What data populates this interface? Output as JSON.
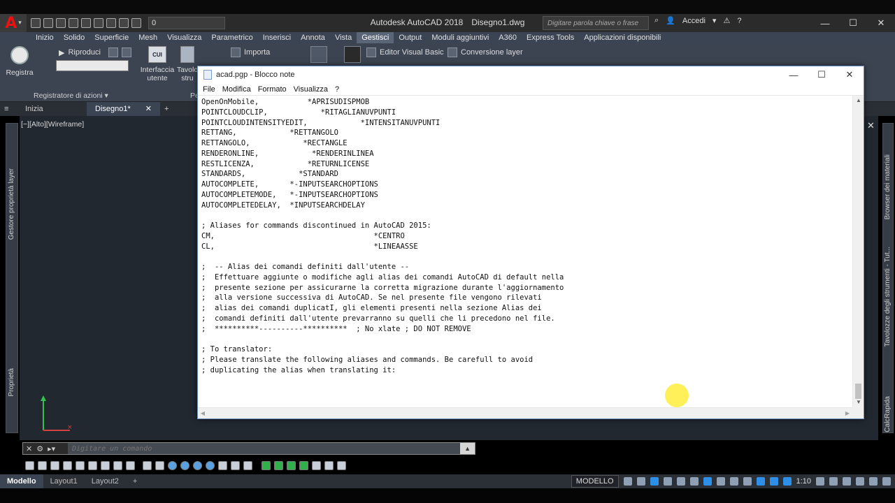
{
  "app": {
    "title": "Autodesk AutoCAD 2018",
    "file": "Disegno1.dwg",
    "layer_value": "0",
    "search_placeholder": "Digitare parola chiave o frase",
    "login": "Accedi",
    "logo_letter": "A"
  },
  "ribbon": {
    "tabs": [
      "Inizio",
      "Solido",
      "Superficie",
      "Mesh",
      "Visualizza",
      "Parametrico",
      "Inserisci",
      "Annota",
      "Vista",
      "Gestisci",
      "Output",
      "Moduli aggiuntivi",
      "A360",
      "Express Tools",
      "Applicazioni disponibili"
    ],
    "active_tab": "Gestisci",
    "record_label": "Registra",
    "replay_label": "Riproduci",
    "action_recorder_label": "Registratore di azioni",
    "cui_badge": "CUI",
    "ui_label_1": "Interfaccia",
    "ui_label_2": "utente",
    "tool_label_1": "Tavolo",
    "tool_label_2": "stru",
    "import_label": "Importa",
    "vba_label": "Editor Visual Basic",
    "layer_conv_label": "Conversione layer",
    "panel_label_p": "Pe"
  },
  "doc_tabs": [
    "Inizia",
    "Disegno1*"
  ],
  "viewport_label": "[−][Alto][Wireframe]",
  "palettes": {
    "left_top": "Gestore proprietà layer",
    "left_bottom": "Proprietà",
    "right_top": "Browser dei materiali",
    "right_mid": "Tavolozze degli strumenti - Tut...",
    "right_bottom": "CalcRapida"
  },
  "command_line": {
    "placeholder": "Digitare un comando"
  },
  "layout_tabs": [
    "Modello",
    "Layout1",
    "Layout2"
  ],
  "status": {
    "model": "MODELLO",
    "scale": "1:10"
  },
  "notepad": {
    "title": "acad.pgp - Blocco note",
    "menu": [
      "File",
      "Modifica",
      "Formato",
      "Visualizza",
      "?"
    ],
    "lines": [
      "OpenOnMobile,           *APRISUDISPMOB",
      "POINTCLOUDCLIP,            *RITAGLIANUVPUNTI",
      "POINTCLOUDINTENSITYEDIT,            *INTENSITANUVPUNTI",
      "RETTANG,            *RETTANGOLO",
      "RETTANGOLO,            *RECTANGLE",
      "RENDERONLINE,            *RENDERINLINEA",
      "RESTLICENZA,            *RETURNLICENSE",
      "STANDARDS,            *STANDARD",
      "AUTOCOMPLETE,       *-INPUTSEARCHOPTIONS",
      "AUTOCOMPLETEMODE,   *-INPUTSEARCHOPTIONS",
      "AUTOCOMPLETEDELAY,  *INPUTSEARCHDELAY",
      "",
      "; Aliases for commands discontinued in AutoCAD 2015:",
      "CM,                                    *CENTRO",
      "CL,                                    *LINEAASSE",
      "",
      ";  -- Alias dei comandi definiti dall'utente --",
      ";  Effettuare aggiunte o modifiche agli alias dei comandi AutoCAD di default nella",
      ";  presente sezione per assicurarne la corretta migrazione durante l'aggiornamento",
      ";  alla versione successiva di AutoCAD. Se nel presente file vengono rilevati",
      ";  alias dei comandi duplicatI, gli elementi presenti nella sezione Alias dei",
      ";  comandi definiti dall'utente prevarranno su quelli che li precedono nel file.",
      ";  **********----------**********  ; No xlate ; DO NOT REMOVE",
      "",
      "; To translator:",
      "; Please translate the following aliases and commands. Be carefull to avoid",
      "; duplicating the alias when translating it:"
    ]
  }
}
